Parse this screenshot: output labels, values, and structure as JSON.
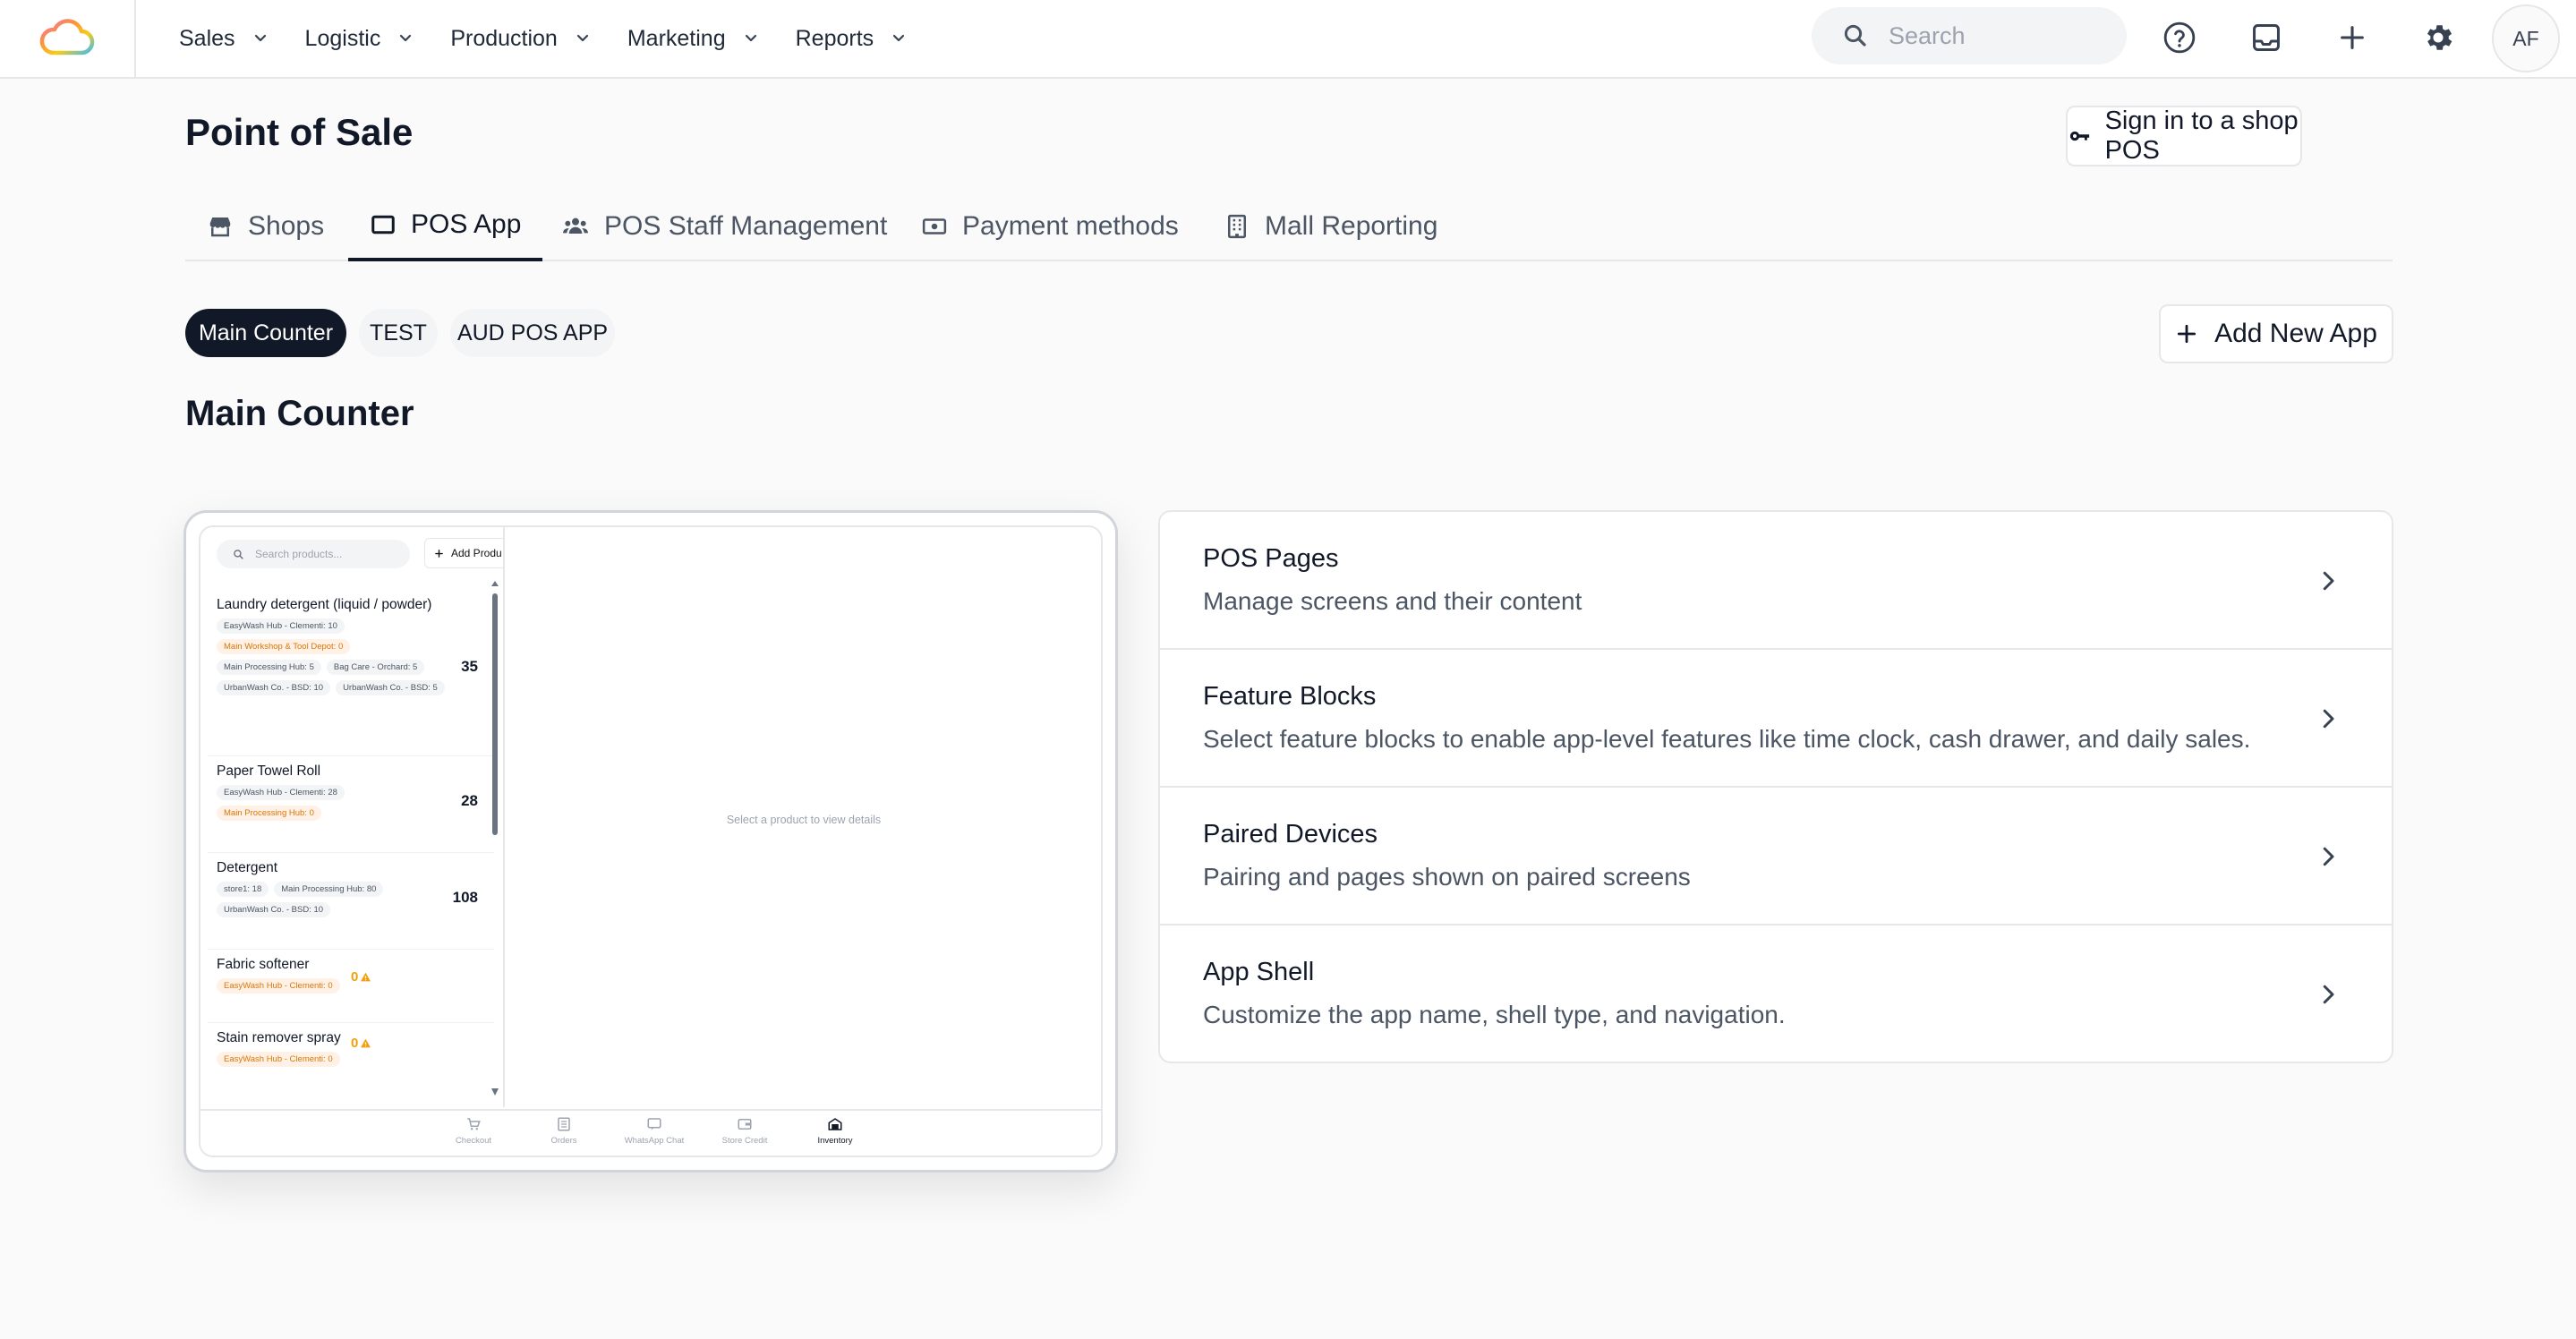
{
  "nav": {
    "logo": "cloud-logo",
    "items": [
      {
        "label": "Sales"
      },
      {
        "label": "Logistic"
      },
      {
        "label": "Production"
      },
      {
        "label": "Marketing"
      },
      {
        "label": "Reports"
      }
    ],
    "search_placeholder": "Search",
    "icons": [
      "help-icon",
      "inbox-icon",
      "plus-icon",
      "gear-icon"
    ],
    "avatar_initials": "AF"
  },
  "page": {
    "title": "Point of Sale",
    "signin_label": "Sign in to a shop POS"
  },
  "tabs": [
    {
      "label": "Shops",
      "icon": "store-icon"
    },
    {
      "label": "POS App",
      "icon": "tablet-icon",
      "active": true
    },
    {
      "label": "POS Staff Management",
      "icon": "users-icon"
    },
    {
      "label": "Payment methods",
      "icon": "cash-icon"
    },
    {
      "label": "Mall Reporting",
      "icon": "building-icon"
    }
  ],
  "apps": {
    "chips": [
      {
        "label": "Main Counter",
        "active": true
      },
      {
        "label": "TEST"
      },
      {
        "label": "AUD POS APP"
      }
    ],
    "add_label": "Add New App",
    "selected_title": "Main Counter"
  },
  "preview": {
    "search_placeholder": "Search products...",
    "add_label": "Add Produ",
    "products": [
      {
        "name": "Laundry detergent (liquid / powder)",
        "qty": "35",
        "tags": [
          {
            "text": "EasyWash Hub - Clementi: 10"
          },
          {
            "text": "Main Workshop & Tool Depot: 0",
            "warn": true
          },
          {
            "text": "Main Processing Hub: 5"
          },
          {
            "text": "Bag Care - Orchard: 5"
          },
          {
            "text": "UrbanWash Co. - BSD: 10"
          },
          {
            "text": "UrbanWash Co. - BSD: 5"
          }
        ]
      },
      {
        "name": "Paper Towel Roll",
        "qty": "28",
        "tags": [
          {
            "text": "EasyWash Hub - Clementi: 28"
          },
          {
            "text": "Main Processing Hub: 0",
            "warn": true
          }
        ]
      },
      {
        "name": "Detergent",
        "qty": "108",
        "tags": [
          {
            "text": "store1: 18"
          },
          {
            "text": "Main Processing Hub: 80"
          },
          {
            "text": "UrbanWash Co. - BSD: 10"
          }
        ]
      },
      {
        "name": "Fabric softener",
        "qty": "0",
        "tags": [
          {
            "text": "EasyWash Hub - Clementi: 0",
            "warn": true
          }
        ]
      },
      {
        "name": "Stain remover spray",
        "qty": "0",
        "tags": [
          {
            "text": "EasyWash Hub - Clementi: 0",
            "warn": true
          }
        ]
      }
    ],
    "empty_detail": "Select a product to view details",
    "bottom_nav": [
      {
        "label": "Checkout",
        "icon": "cart-icon"
      },
      {
        "label": "Orders",
        "icon": "orders-icon"
      },
      {
        "label": "WhatsApp Chat",
        "icon": "chat-icon"
      },
      {
        "label": "Store Credit",
        "icon": "wallet-icon"
      },
      {
        "label": "Inventory",
        "icon": "inventory-icon",
        "active": true
      }
    ]
  },
  "settings": [
    {
      "title": "POS Pages",
      "desc": "Manage screens and their content"
    },
    {
      "title": "Feature Blocks",
      "desc": "Select feature blocks to enable app-level features like time clock, cash drawer, and daily sales."
    },
    {
      "title": "Paired Devices",
      "desc": "Pairing and pages shown on paired screens"
    },
    {
      "title": "App Shell",
      "desc": "Customize the app name, shell type, and navigation."
    }
  ],
  "colors": {
    "accent": "#111827",
    "warning": "#f59e0b",
    "border": "#e5e7eb"
  }
}
